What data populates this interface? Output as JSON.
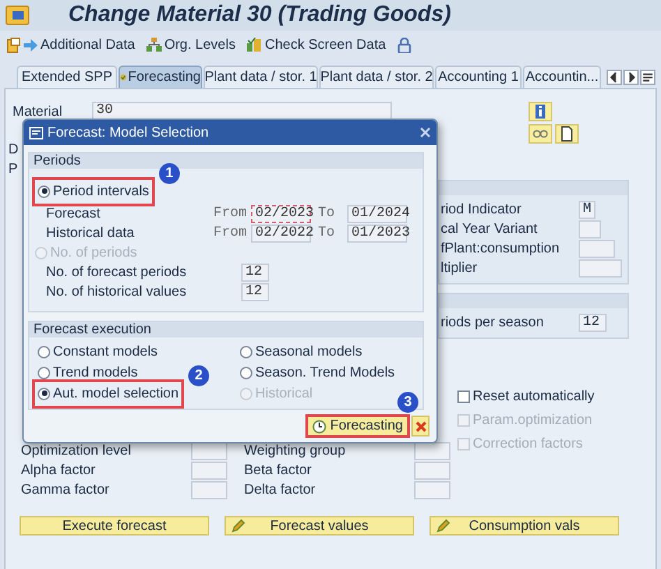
{
  "window": {
    "title": "Change Material 30 (Trading Goods)"
  },
  "toolbar": [
    {
      "kind": "arrow",
      "label": "Additional Data"
    },
    {
      "kind": "org",
      "label": "Org. Levels"
    },
    {
      "kind": "check",
      "label": "Check Screen Data"
    },
    {
      "kind": "lock"
    }
  ],
  "tabs": [
    {
      "label": "Extended SPP",
      "selected": false
    },
    {
      "label": "Forecasting",
      "selected": true
    },
    {
      "label": "Plant data / stor. 1",
      "selected": false
    },
    {
      "label": "Plant data / stor. 2",
      "selected": false
    },
    {
      "label": "Accounting 1",
      "selected": false
    },
    {
      "label": "Accountin...",
      "selected": false
    }
  ],
  "material": {
    "label": "Material",
    "value": "30"
  },
  "cut_labels": [
    "D",
    "P"
  ],
  "forecast_params": [
    {
      "label": "riod Indicator",
      "value": "M"
    },
    {
      "label": "cal Year Variant"
    },
    {
      "label": "fPlant:consumption"
    },
    {
      "label": "ltiplier"
    }
  ],
  "season": {
    "label": "riods per season",
    "value": "12"
  },
  "options": [
    {
      "label": "Reset automatically",
      "checked": false,
      "disabled": false
    },
    {
      "label": "Param.optimization",
      "checked": false,
      "disabled": true
    },
    {
      "label": "Correction factors",
      "checked": false,
      "disabled": true
    }
  ],
  "factors": [
    {
      "label": "Optimization level"
    },
    {
      "label": "Weighting group"
    },
    {
      "label": "Alpha factor"
    },
    {
      "label": "Beta factor"
    },
    {
      "label": "Gamma factor"
    },
    {
      "label": "Delta factor"
    }
  ],
  "actions": [
    {
      "label": "Execute forecast",
      "icon": false
    },
    {
      "label": "Forecast values",
      "icon": true
    },
    {
      "label": "Consumption vals",
      "icon": true
    }
  ],
  "dialog": {
    "title": "Forecast: Model Selection",
    "periods": {
      "title": "Periods",
      "modes": [
        {
          "label": "Period intervals",
          "selected": true,
          "disabled": false,
          "highlighted": true,
          "step": "1"
        },
        {
          "label": "No. of periods",
          "selected": false,
          "disabled": true,
          "highlighted": false
        }
      ],
      "ranges": [
        {
          "label": "Forecast",
          "from_label": "From",
          "from": "02/2023",
          "to_label": "To",
          "to": "01/2024",
          "marked": true
        },
        {
          "label": "Historical data",
          "from_label": "From",
          "from": "02/2022",
          "to_label": "To",
          "to": "01/2023",
          "marked": false
        }
      ],
      "counts": [
        {
          "label": "No. of forecast periods",
          "value": "12"
        },
        {
          "label": "No. of historical values",
          "value": "12"
        }
      ]
    },
    "execution": {
      "title": "Forecast execution",
      "models": [
        {
          "label": "Constant models",
          "selected": false,
          "disabled": false,
          "highlighted": false
        },
        {
          "label": "Trend models",
          "selected": false,
          "disabled": false,
          "highlighted": false
        },
        {
          "label": "Aut. model selection",
          "selected": true,
          "disabled": false,
          "highlighted": true,
          "step": "2"
        },
        {
          "label": "Seasonal models",
          "selected": false,
          "disabled": false,
          "highlighted": false
        },
        {
          "label": "Season. Trend Models",
          "selected": false,
          "disabled": false,
          "highlighted": false
        },
        {
          "label": "Historical",
          "selected": false,
          "disabled": true,
          "highlighted": false
        }
      ]
    },
    "confirm": {
      "label": "Forecasting",
      "highlighted": true,
      "step": "3"
    }
  }
}
